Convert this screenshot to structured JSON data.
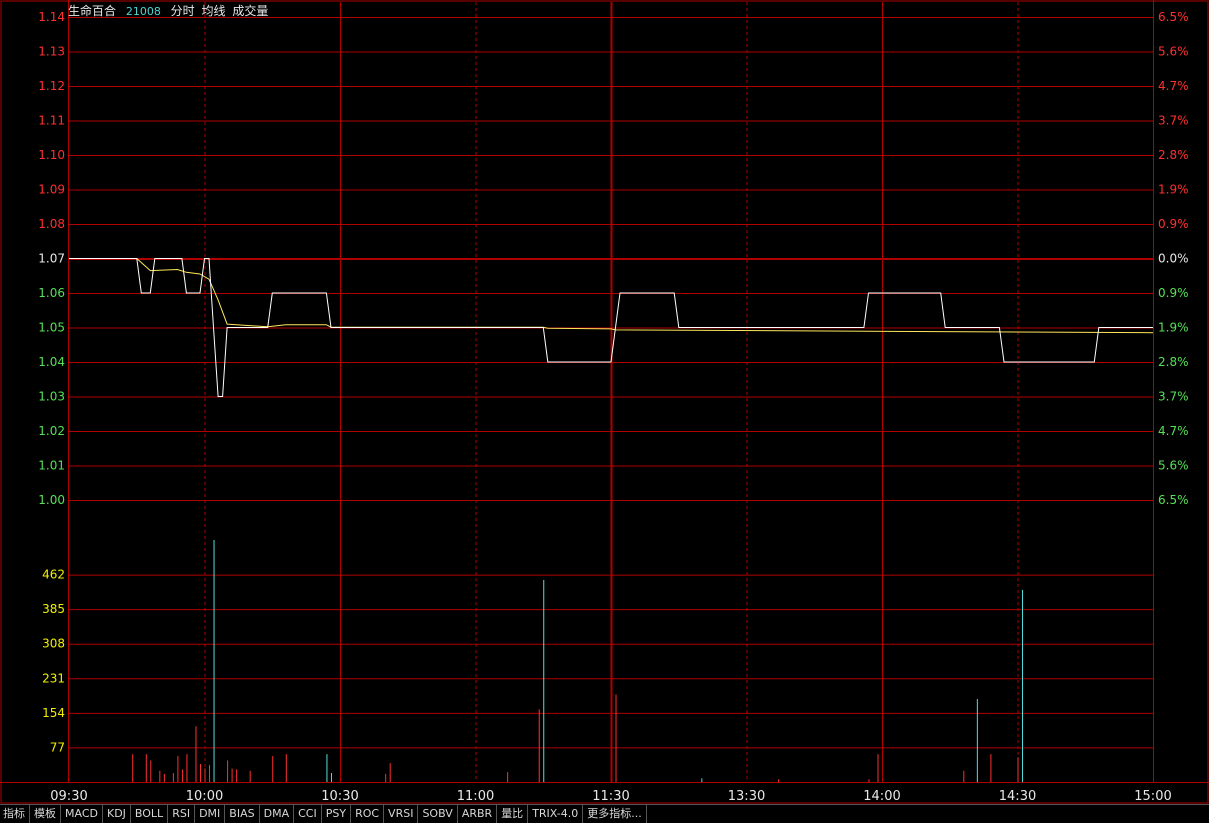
{
  "header": {
    "stock_name": "生命百合",
    "stock_code": "21008",
    "label_time": "分时",
    "label_avg": "均线",
    "label_volume": "成交量"
  },
  "colors": {
    "background": "#000000",
    "grid": "#b00000",
    "price_line": "#ffffff",
    "avg_line": "#ffe65a",
    "up": "#ff3030",
    "down": "#55e055",
    "flat": "#e8e8e8",
    "volume_up": "#ff3030",
    "volume_down": "#55dddd"
  },
  "chart_data": {
    "type": "line",
    "prev_close": 1.07,
    "price_axis": {
      "ticks": [
        "1.14",
        "1.13",
        "1.12",
        "1.11",
        "1.10",
        "1.09",
        "1.08",
        "1.07",
        "1.06",
        "1.05",
        "1.04",
        "1.03",
        "1.02",
        "1.01",
        "1.00"
      ],
      "ylim": [
        1.0,
        1.14
      ]
    },
    "percent_axis": {
      "ticks": [
        "6.5%",
        "5.6%",
        "4.7%",
        "3.7%",
        "2.8%",
        "1.9%",
        "0.9%",
        "0.0%",
        "0.9%",
        "1.9%",
        "2.8%",
        "3.7%",
        "4.7%",
        "5.6%",
        "6.5%"
      ]
    },
    "volume_axis": {
      "ticks": [
        "462",
        "385",
        "308",
        "231",
        "154",
        "77"
      ],
      "ylim": [
        0,
        539
      ]
    },
    "x_axis": {
      "tick_labels": [
        "09:30",
        "10:00",
        "10:30",
        "11:00",
        "11:30",
        "13:30",
        "14:00",
        "14:30",
        "15:00"
      ],
      "total_minutes": 240
    },
    "series": [
      {
        "key": "price",
        "points": [
          [
            0,
            1.07
          ],
          [
            15,
            1.07
          ],
          [
            16,
            1.06
          ],
          [
            18,
            1.06
          ],
          [
            19,
            1.07
          ],
          [
            25,
            1.07
          ],
          [
            26,
            1.06
          ],
          [
            29,
            1.06
          ],
          [
            30,
            1.07
          ],
          [
            31,
            1.07
          ],
          [
            32,
            1.05
          ],
          [
            33,
            1.03
          ],
          [
            34,
            1.03
          ],
          [
            35,
            1.05
          ],
          [
            44,
            1.05
          ],
          [
            45,
            1.06
          ],
          [
            57,
            1.06
          ],
          [
            58,
            1.05
          ],
          [
            105,
            1.05
          ],
          [
            106,
            1.04
          ],
          [
            120,
            1.04
          ],
          [
            121,
            1.05
          ],
          [
            122,
            1.06
          ],
          [
            134,
            1.06
          ],
          [
            135,
            1.05
          ],
          [
            176,
            1.05
          ],
          [
            177,
            1.06
          ],
          [
            193,
            1.06
          ],
          [
            194,
            1.05
          ],
          [
            206,
            1.05
          ],
          [
            207,
            1.04
          ],
          [
            227,
            1.04
          ],
          [
            228,
            1.05
          ],
          [
            240,
            1.05
          ]
        ]
      },
      {
        "key": "average",
        "points": [
          [
            0,
            1.07
          ],
          [
            15,
            1.07
          ],
          [
            18,
            1.0665
          ],
          [
            24,
            1.0668
          ],
          [
            26,
            1.066
          ],
          [
            29,
            1.0655
          ],
          [
            31,
            1.064
          ],
          [
            33,
            1.058
          ],
          [
            35,
            1.051
          ],
          [
            44,
            1.0502
          ],
          [
            48,
            1.0508
          ],
          [
            57,
            1.0508
          ],
          [
            58,
            1.0501
          ],
          [
            105,
            1.0501
          ],
          [
            106,
            1.0498
          ],
          [
            120,
            1.0496
          ],
          [
            121,
            1.0493
          ],
          [
            240,
            1.0485
          ]
        ]
      }
    ],
    "volume": [
      {
        "m": 14,
        "v": 62,
        "c": "up"
      },
      {
        "m": 17,
        "v": 62,
        "c": "up"
      },
      {
        "m": 18,
        "v": 48,
        "c": "up"
      },
      {
        "m": 20,
        "v": 25,
        "c": "up"
      },
      {
        "m": 21,
        "v": 18,
        "c": "up"
      },
      {
        "m": 23,
        "v": 20,
        "c": "up"
      },
      {
        "m": 24,
        "v": 58,
        "c": "up"
      },
      {
        "m": 25,
        "v": 28,
        "c": "up"
      },
      {
        "m": 26,
        "v": 62,
        "c": "up"
      },
      {
        "m": 28,
        "v": 124,
        "c": "up"
      },
      {
        "m": 29,
        "v": 40,
        "c": "up"
      },
      {
        "m": 30,
        "v": 30,
        "c": "up"
      },
      {
        "m": 31,
        "v": 38,
        "c": "up"
      },
      {
        "m": 32,
        "v": 539,
        "c": "down"
      },
      {
        "m": 35,
        "v": 48,
        "c": "up"
      },
      {
        "m": 36,
        "v": 30,
        "c": "up"
      },
      {
        "m": 37,
        "v": 28,
        "c": "up"
      },
      {
        "m": 40,
        "v": 25,
        "c": "up"
      },
      {
        "m": 45,
        "v": 58,
        "c": "up"
      },
      {
        "m": 48,
        "v": 62,
        "c": "up"
      },
      {
        "m": 57,
        "v": 62,
        "c": "down"
      },
      {
        "m": 58,
        "v": 20,
        "c": "down"
      },
      {
        "m": 70,
        "v": 18,
        "c": "up"
      },
      {
        "m": 71,
        "v": 42,
        "c": "up"
      },
      {
        "m": 97,
        "v": 22,
        "c": "up"
      },
      {
        "m": 104,
        "v": 162,
        "c": "up"
      },
      {
        "m": 105,
        "v": 450,
        "c": "down"
      },
      {
        "m": 121,
        "v": 195,
        "c": "up"
      },
      {
        "m": 140,
        "v": 8,
        "c": "down"
      },
      {
        "m": 157,
        "v": 6,
        "c": "up"
      },
      {
        "m": 177,
        "v": 6,
        "c": "up"
      },
      {
        "m": 179,
        "v": 62,
        "c": "up"
      },
      {
        "m": 198,
        "v": 25,
        "c": "up"
      },
      {
        "m": 201,
        "v": 185,
        "c": "down"
      },
      {
        "m": 204,
        "v": 62,
        "c": "up"
      },
      {
        "m": 210,
        "v": 55,
        "c": "up"
      },
      {
        "m": 211,
        "v": 428,
        "c": "down"
      }
    ]
  },
  "tabs": [
    "指标",
    "模板",
    "MACD",
    "KDJ",
    "BOLL",
    "RSI",
    "DMI",
    "BIAS",
    "DMA",
    "CCI",
    "PSY",
    "ROC",
    "VRSI",
    "SOBV",
    "ARBR",
    "量比",
    "TRIX-4.0",
    "更多指标..."
  ]
}
